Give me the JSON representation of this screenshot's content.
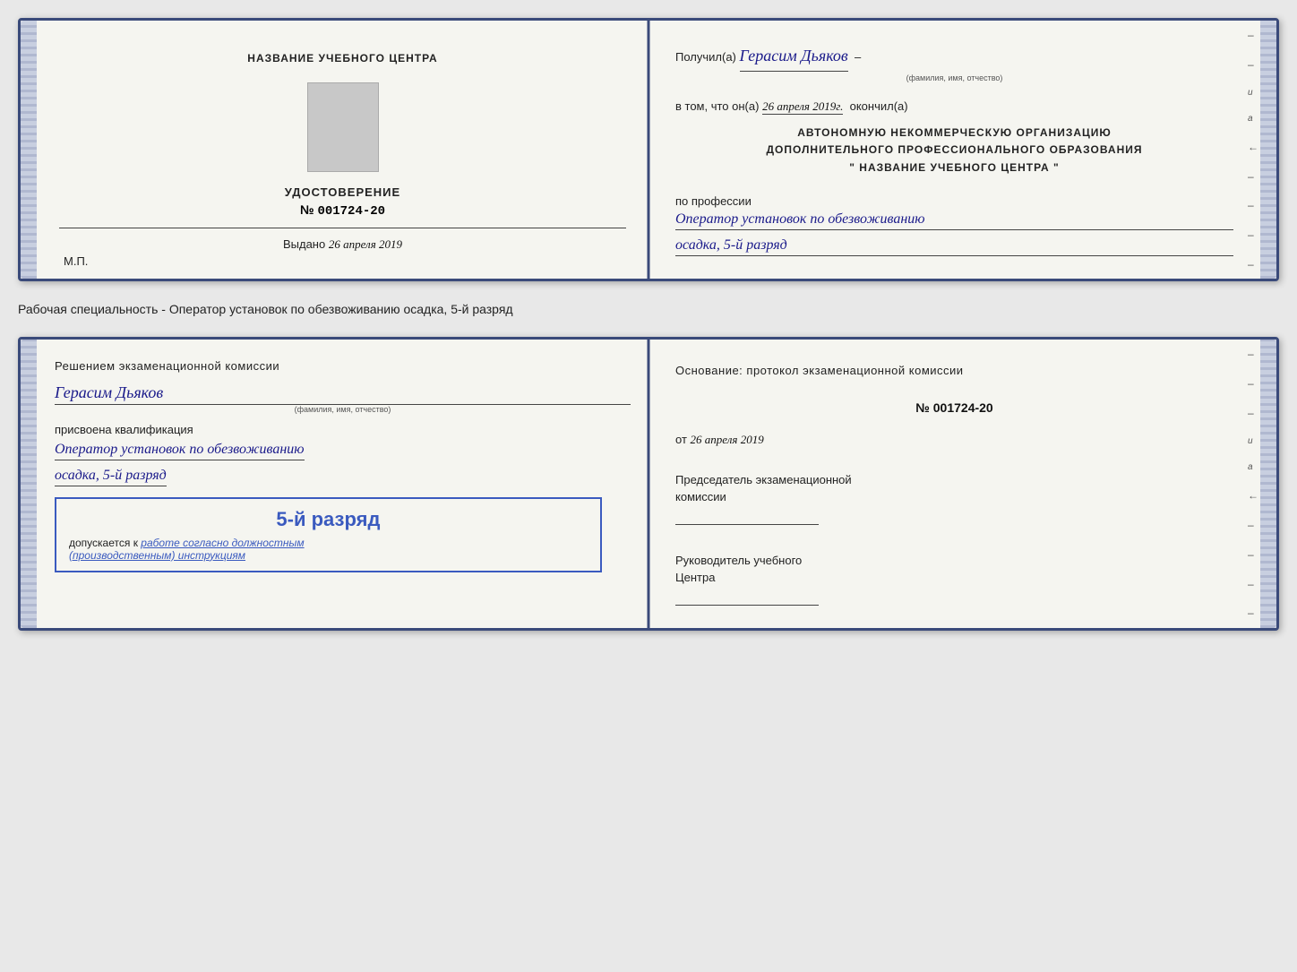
{
  "page": {
    "background": "#e8e8e8"
  },
  "top_cert": {
    "left": {
      "org_name": "НАЗВАНИЕ УЧЕБНОГО ЦЕНТРА",
      "cert_title": "УДОСТОВЕРЕНИЕ",
      "cert_number_prefix": "№",
      "cert_number": "001724-20",
      "issued_label": "Выдано",
      "issued_date": "26 апреля 2019",
      "mp_label": "М.П."
    },
    "right": {
      "received_prefix": "Получил(а)",
      "recipient_name": "Герасим Дьяков",
      "recipient_label": "(фамилия, имя, отчество)",
      "in_that_text": "в том, что он(а)",
      "completion_date": "26 апреля 2019г.",
      "completed_label": "окончил(а)",
      "org_line1": "АВТОНОМНУЮ НЕКОММЕРЧЕСКУЮ ОРГАНИЗАЦИЮ",
      "org_line2": "ДОПОЛНИТЕЛЬНОГО ПРОФЕССИОНАЛЬНОГО ОБРАЗОВАНИЯ",
      "org_line3": "\" НАЗВАНИЕ УЧЕБНОГО ЦЕНТРА \"",
      "profession_label": "по профессии",
      "profession": "Оператор установок по обезвоживанию",
      "rank": "осадка, 5-й разряд"
    }
  },
  "description": "Рабочая специальность - Оператор установок по обезвоживанию осадка, 5-й разряд",
  "bottom_cert": {
    "left": {
      "decision_text": "Решением экзаменационной комиссии",
      "person_name": "Герасим Дьяков",
      "person_label": "(фамилия, имя, отчество)",
      "assigned_text": "присвоена квалификация",
      "profession": "Оператор установок по обезвоживанию",
      "rank": "осадка, 5-й разряд",
      "stamp_rank": "5-й разряд",
      "allowed_text": "допускается к",
      "allowed_underline": "работе согласно должностным",
      "allowed_italic": "(производственным) инструкциям"
    },
    "right": {
      "basis_text": "Основание: протокол экзаменационной комиссии",
      "number_prefix": "№",
      "number": "001724-20",
      "date_prefix": "от",
      "date": "26 апреля 2019",
      "chairman_label": "Председатель экзаменационной",
      "chairman_label2": "комиссии",
      "director_label": "Руководитель учебного",
      "director_label2": "Центра"
    }
  }
}
